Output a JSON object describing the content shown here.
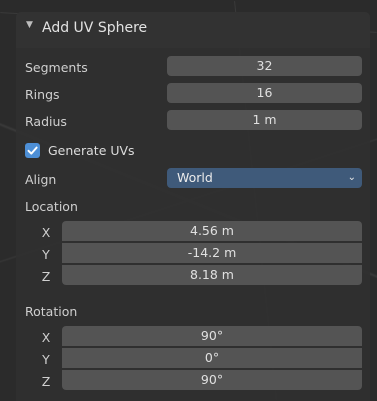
{
  "panel": {
    "title": "Add UV Sphere",
    "segments_label": "Segments",
    "segments_value": "32",
    "rings_label": "Rings",
    "rings_value": "16",
    "radius_label": "Radius",
    "radius_value": "1 m",
    "generate_uvs_label": "Generate UVs",
    "generate_uvs_checked": true,
    "align_label": "Align",
    "align_value": "World",
    "location_label": "Location",
    "location": {
      "x_label": "X",
      "x": "4.56 m",
      "y_label": "Y",
      "y": "-14.2 m",
      "z_label": "Z",
      "z": "8.18 m"
    },
    "rotation_label": "Rotation",
    "rotation": {
      "x_label": "X",
      "x": "90°",
      "y_label": "Y",
      "y": "0°",
      "z_label": "Z",
      "z": "90°"
    }
  },
  "colors": {
    "checkbox_accent": "#4d8fd6",
    "select_background": "#3f5a7a",
    "field_background": "#545454"
  },
  "icons": [
    "collapse-arrow-icon",
    "checkmark-icon",
    "chevron-down-icon"
  ]
}
